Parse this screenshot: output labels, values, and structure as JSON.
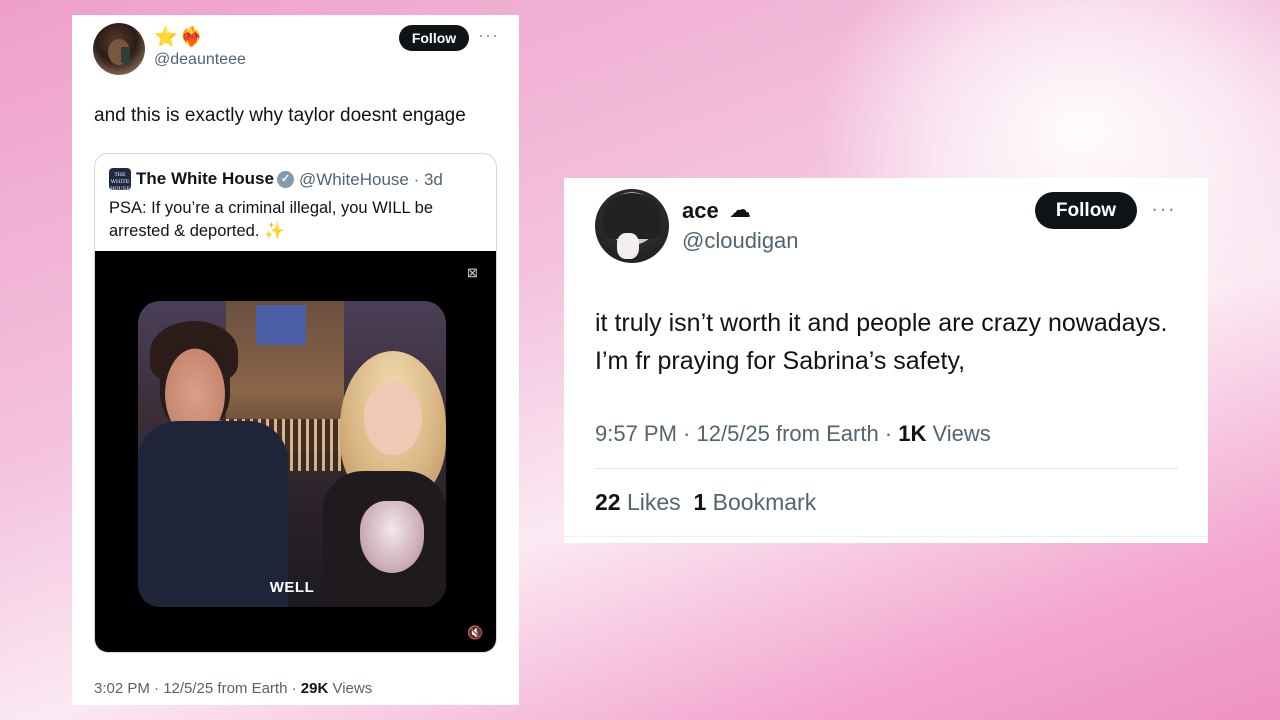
{
  "colors": {
    "background_pink": "#ee9fcb",
    "card_bg": "#ffffff",
    "text_primary": "#0f1419",
    "text_secondary": "#536471",
    "follow_button": "#0f1419",
    "verified_badge": "#829aab"
  },
  "left_tweet": {
    "display_name_emojis": "⭐❤️‍🔥",
    "handle": "@deaunteee",
    "follow_label": "Follow",
    "more_icon": "more-horizontal-icon",
    "text": "and this is exactly why taylor doesnt engage",
    "quoted": {
      "logo_text": "THE WHITE HOUSE",
      "name": "The White House",
      "verified_icon": "verified-badge-icon",
      "handle_time": "@WhiteHouse · 3d",
      "text": "PSA: If you’re a criminal illegal, you WILL be arrested & deported. ✨",
      "video": {
        "caption": "WELL",
        "gif_icon": "alt-media-icon",
        "mute_icon": "mute-icon"
      }
    },
    "meta": {
      "time_date": "3:02 PM · 12/5/25 from Earth · ",
      "views_count": "29K",
      "views_label": " Views"
    }
  },
  "right_tweet": {
    "display_name": "ace",
    "name_icon": "cloud-icon",
    "handle": "@cloudigan",
    "follow_label": "Follow",
    "more_icon": "more-horizontal-icon",
    "text": "it truly isn’t worth it and people are crazy nowadays. I’m fr praying for Sabrina’s safety,",
    "meta": {
      "time_date": "9:57 PM · 12/5/25 from Earth · ",
      "views_count": "1K",
      "views_label": " Views"
    },
    "stats": {
      "likes_count": "22",
      "likes_label": " Likes",
      "bookmarks_count": "1",
      "bookmarks_label": " Bookmark"
    }
  }
}
